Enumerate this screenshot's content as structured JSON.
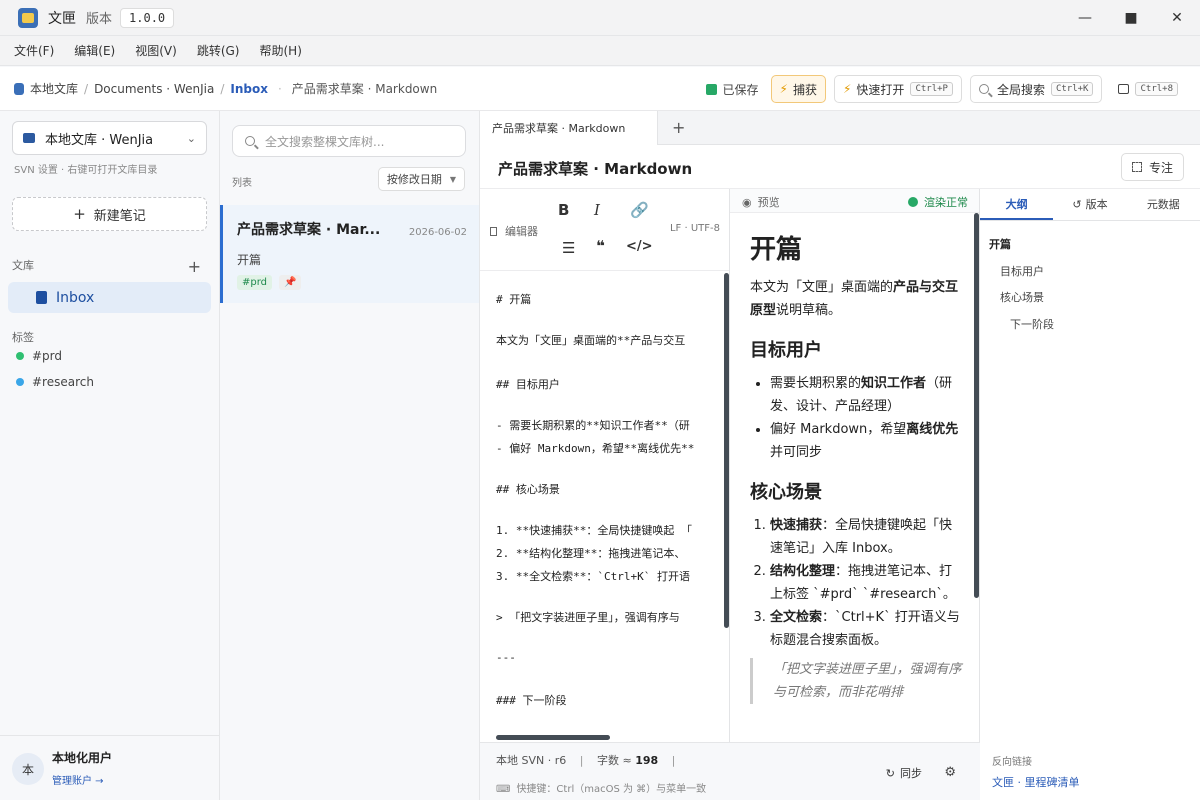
{
  "app": {
    "title": "文匣",
    "version_label": "版本",
    "version": "1.0.0"
  },
  "window_controls": {
    "minimize": "—",
    "maximize": "■",
    "close": "✕"
  },
  "menu": [
    "文件(F)",
    "编辑(E)",
    "视图(V)",
    "跳转(G)",
    "帮助(H)"
  ],
  "breadcrumb": {
    "root": "本地文库",
    "path": "Documents · WenJia",
    "folder": "Inbox",
    "doc": "产品需求草案 · Markdown"
  },
  "toolbar": {
    "saved": "已保存",
    "capture": "捕获",
    "quick_open": "快速打开",
    "quick_open_kbd": "Ctrl+P",
    "global_search": "全局搜索",
    "global_search_kbd": "Ctrl+K",
    "panel_kbd": "Ctrl+8"
  },
  "sidebar": {
    "library": "本地文库 · WenJia",
    "svn_hint": "SVN 设置 · 右键可打开文库目录",
    "new_note": "新建笔记",
    "library_head": "文库",
    "inbox": "Inbox",
    "tags_head": "标签",
    "tags": [
      {
        "name": "#prd",
        "color": "#2fbf71"
      },
      {
        "name": "#research",
        "color": "#3aa6e8"
      }
    ],
    "user": {
      "avatar": "本",
      "name": "本地化用户",
      "manage": "管理账户 →"
    }
  },
  "list": {
    "search_placeholder": "全文搜索整棵文库树...",
    "label": "列表",
    "sort": "按修改日期",
    "notes": [
      {
        "title": "产品需求草案 · Mar...",
        "date": "2026-06-02",
        "subtitle": "开篇",
        "tag": "#prd",
        "pin": "📌"
      }
    ]
  },
  "editor": {
    "tab": "产品需求草案 · Markdown",
    "doc_title": "产品需求草案 · Markdown",
    "focus": "专注",
    "label": "编辑器",
    "encoding": "LF · UTF-8",
    "lines": [
      "# 开篇",
      "本文为「文匣」桌面端的**产品与交互",
      "## 目标用户",
      "- 需要长期积累的**知识工作者**（研",
      "- 偏好 Markdown，希望**离线优先**",
      "## 核心场景",
      "1. **快速捕获**：全局快捷键唤起 「",
      "2. **结构化整理**：拖拽进笔记本、",
      "3. **全文检索**：`Ctrl+K` 打开语",
      "> 「把文字装进匣子里」，强调有序与",
      "---",
      "### 下一阶段"
    ]
  },
  "preview": {
    "label": "预览",
    "status": "渲染正常",
    "h1": "开篇",
    "intro_a": "本文为「文匣」桌面端的",
    "intro_b": "产品与交互原型",
    "intro_c": "说明草稿。",
    "h2_users": "目标用户",
    "user1_a": "需要长期积累的",
    "user1_b": "知识工作者",
    "user1_c": "（研发、设计、产品经理）",
    "user2_a": "偏好 Markdown，希望",
    "user2_b": "离线优先",
    "user2_c": "并可同步",
    "h2_scenes": "核心场景",
    "scene1_a": "快速捕获",
    "scene1_b": "：全局快捷键唤起「快速笔记」入库 Inbox。",
    "scene2_a": "结构化整理",
    "scene2_b": "：拖拽进笔记本、打上标签 `#prd` `#research`。",
    "scene3_a": "全文检索",
    "scene3_b": "：`Ctrl+K` 打开语义与标题混合搜索面板。",
    "quote": "「把文字装进匣子里」，强调有序与可检索，而非花哨排"
  },
  "right": {
    "tabs": [
      "大纲",
      "版本",
      "元数据"
    ],
    "outline": [
      {
        "text": "开篇",
        "level": 1
      },
      {
        "text": "目标用户",
        "level": 2
      },
      {
        "text": "核心场景",
        "level": 2
      },
      {
        "text": "下一阶段",
        "level": 3
      }
    ],
    "backlinks_head": "反向链接",
    "backlink": "文匣 · 里程碑清单"
  },
  "status": {
    "svn": "本地 SVN · r6",
    "words_label": "字数 ≈",
    "words": "198",
    "shortcut": "快捷键：Ctrl（macOS 为 ⌘）与菜单一致",
    "sync": "同步"
  }
}
